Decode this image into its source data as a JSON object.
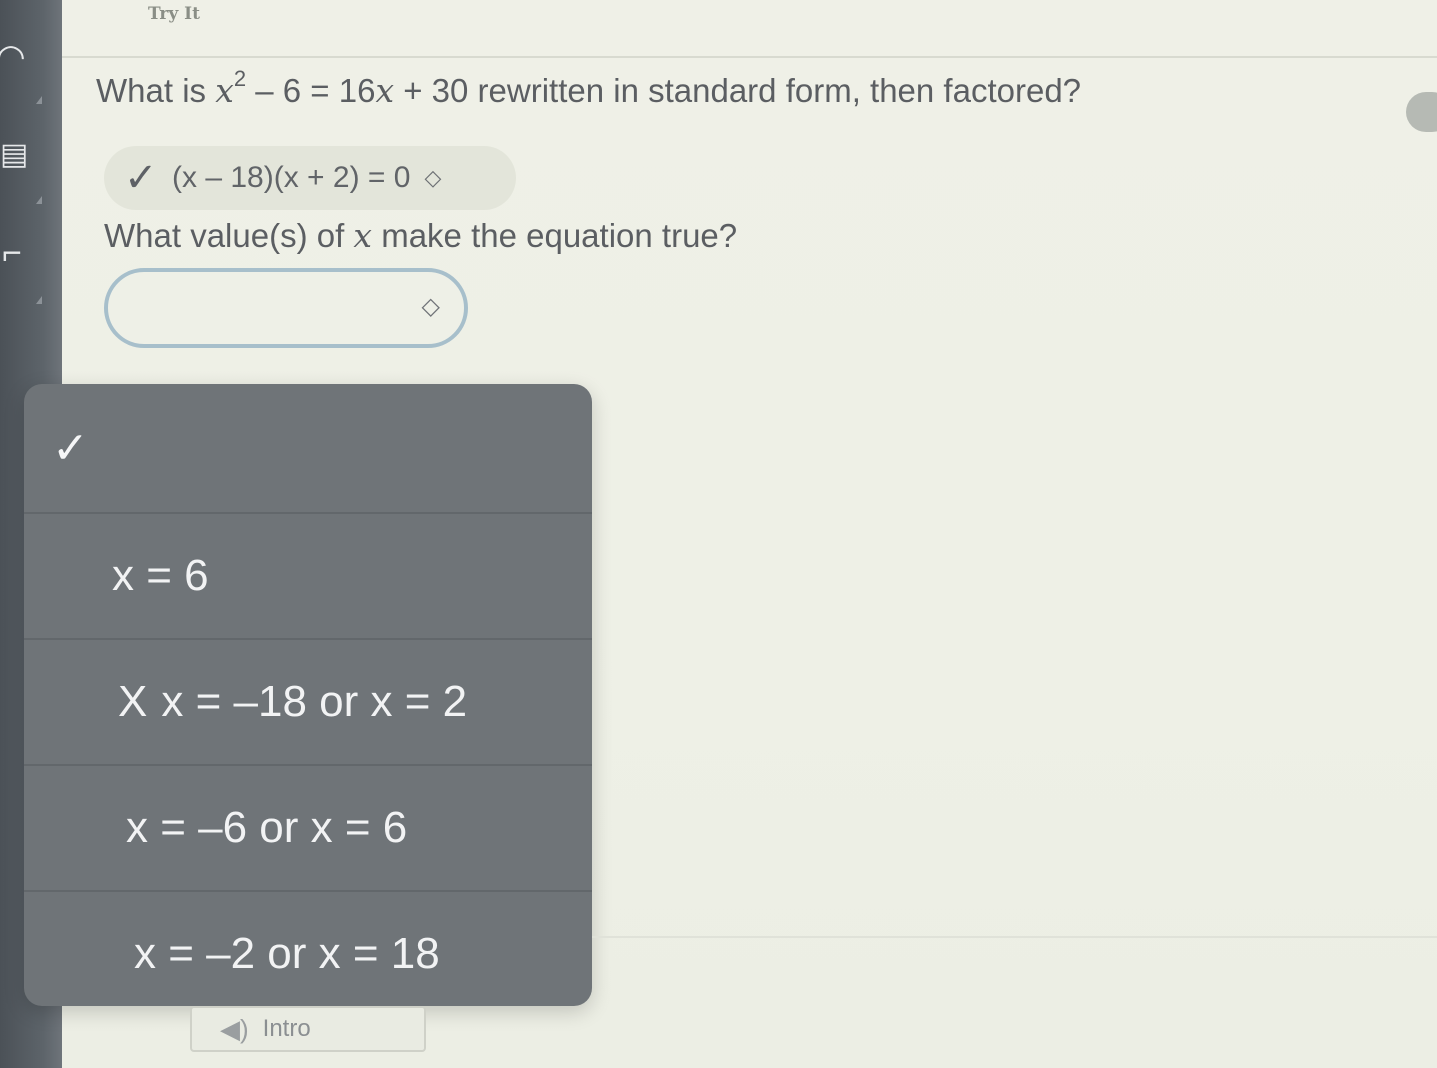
{
  "header": {
    "tab_label": "Try It"
  },
  "question1": {
    "prefix": "What is ",
    "var": "x",
    "exponent": "2",
    "middle": " – 6 = 16",
    "var2": "x",
    "suffix": " + 30 rewritten in standard form, then factored?"
  },
  "answer1": {
    "check_icon": "check-icon",
    "value": "(x – 18)(x + 2) = 0",
    "toggle_icon": "up-down-chevron-icon"
  },
  "question2": {
    "prefix": "What value(s) of ",
    "var": "x",
    "suffix": " make the equation true?"
  },
  "answer2": {
    "value": "",
    "toggle_icon": "up-down-chevron-icon"
  },
  "dropdown": {
    "options": [
      {
        "label": "",
        "selected_marker": "✓"
      },
      {
        "label": "x = 6"
      },
      {
        "label": "x = –18 or x = 2",
        "marker": "X"
      },
      {
        "label": "x = –6 or x = 6"
      },
      {
        "label": "x = –2 or x = 18"
      }
    ]
  },
  "footer": {
    "intro_label": "Intro",
    "intro_icon": "speaker-icon"
  },
  "colors": {
    "background": "#eceee3",
    "dropdown_bg": "#6f7478",
    "focus_border": "#a7bfcb",
    "sidebar": "#4b5157"
  }
}
